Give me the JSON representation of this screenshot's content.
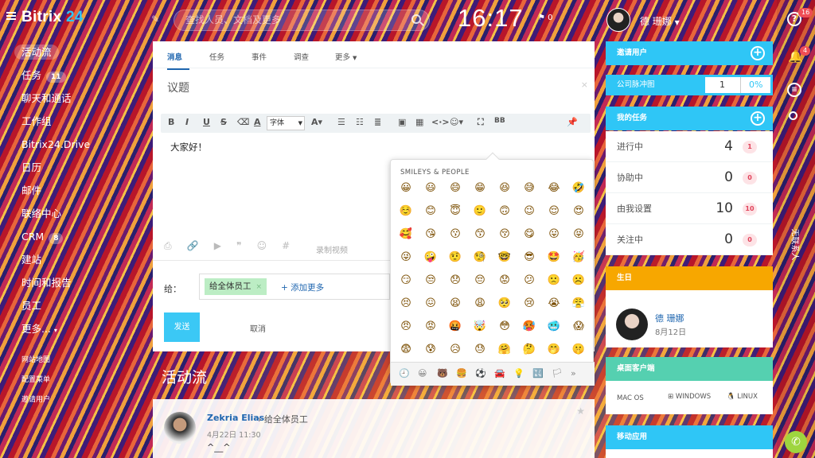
{
  "app": {
    "logo_main": "Bitrix",
    "logo_num": "24",
    "time": "16:17",
    "flag_count": "0",
    "user": "德 珊娜"
  },
  "search": {
    "placeholder": "查找人员、文档及更多"
  },
  "right_bar": {
    "help_badge": "16",
    "bell_badge": "4",
    "vertical_label": "无联系人"
  },
  "menu": {
    "items": [
      {
        "label": "活动流"
      },
      {
        "label": "任务",
        "count": "11"
      },
      {
        "label": "聊天和通话"
      },
      {
        "label": "工作组"
      },
      {
        "label": "Bitrix24.Drive"
      },
      {
        "label": "日历"
      },
      {
        "label": "邮件"
      },
      {
        "label": "联络中心"
      },
      {
        "label": "CRM",
        "count": "8"
      },
      {
        "label": "建站"
      },
      {
        "label": "时间和报告"
      },
      {
        "label": "员工"
      },
      {
        "label": "更多..."
      }
    ],
    "small": [
      "网站地图",
      "配置菜单",
      "邀请用户"
    ]
  },
  "editor": {
    "tabs": [
      "消息",
      "任务",
      "事件",
      "调查",
      "更多"
    ],
    "topic": "议题",
    "font": "字体",
    "text": "大家好！",
    "record_video": "录制视频",
    "to_label": "给：",
    "recipient": "给全体员工",
    "add_more": "添加更多",
    "send": "发送",
    "cancel": "取消"
  },
  "emoji": {
    "heading": "SMILEYS & PEOPLE",
    "rows": [
      [
        "😀",
        "😃",
        "😄",
        "😁",
        "😆",
        "😅",
        "😂",
        "🤣"
      ],
      [
        "☺️",
        "😊",
        "😇",
        "🙂",
        "🙃",
        "😉",
        "😌",
        "😍"
      ],
      [
        "🥰",
        "😘",
        "😗",
        "😙",
        "😚",
        "😋",
        "😛",
        "😝"
      ],
      [
        "😜",
        "🤪",
        "🤨",
        "🧐",
        "🤓",
        "😎",
        "🤩",
        "🥳"
      ],
      [
        "😏",
        "😒",
        "😞",
        "😔",
        "😟",
        "😕",
        "🙁",
        "☹️"
      ],
      [
        "😣",
        "😖",
        "😫",
        "😩",
        "🥺",
        "😢",
        "😭",
        "😤"
      ],
      [
        "😠",
        "😡",
        "🤬",
        "🤯",
        "😳",
        "🥵",
        "🥶",
        "😱"
      ],
      [
        "😨",
        "😰",
        "😥",
        "😓",
        "🤗",
        "🤔",
        "🤭",
        "🤫"
      ]
    ],
    "footer": [
      "🕘",
      "😀",
      "🐻",
      "🍔",
      "⚽",
      "🚘",
      "💡",
      "🔣",
      "🏳",
      "»"
    ]
  },
  "feed": {
    "title": "活动流",
    "author": "Zekria Elias",
    "to": "给全体员工",
    "date": "4月22日 11:30",
    "text": "^__^"
  },
  "widgets": {
    "invite": "邀请用户",
    "pulse_label": "公司脉冲图",
    "pulse_value": "1",
    "pulse_pct": "0%",
    "tasks_title": "我的任务",
    "tasks": [
      {
        "label": "进行中",
        "value": "4",
        "badge": "1"
      },
      {
        "label": "协助中",
        "value": "0",
        "badge": "0"
      },
      {
        "label": "由我设置",
        "value": "10",
        "badge": "10"
      },
      {
        "label": "关注中",
        "value": "0",
        "badge": "0"
      }
    ],
    "birthday_title": "生日",
    "bday_name": "德 珊娜",
    "bday_date": "8月12日",
    "desktop_title": "桌面客户端",
    "os": [
      "MAC OS",
      "WINDOWS",
      "LINUX"
    ],
    "mobile_title": "移动应用"
  },
  "colors": {
    "accent": "#2fc6f6",
    "header_blue": "#3bc8f5",
    "birthday": "#f7a700",
    "desktop": "#55d0b0",
    "mobile": "#2fc6f6"
  }
}
